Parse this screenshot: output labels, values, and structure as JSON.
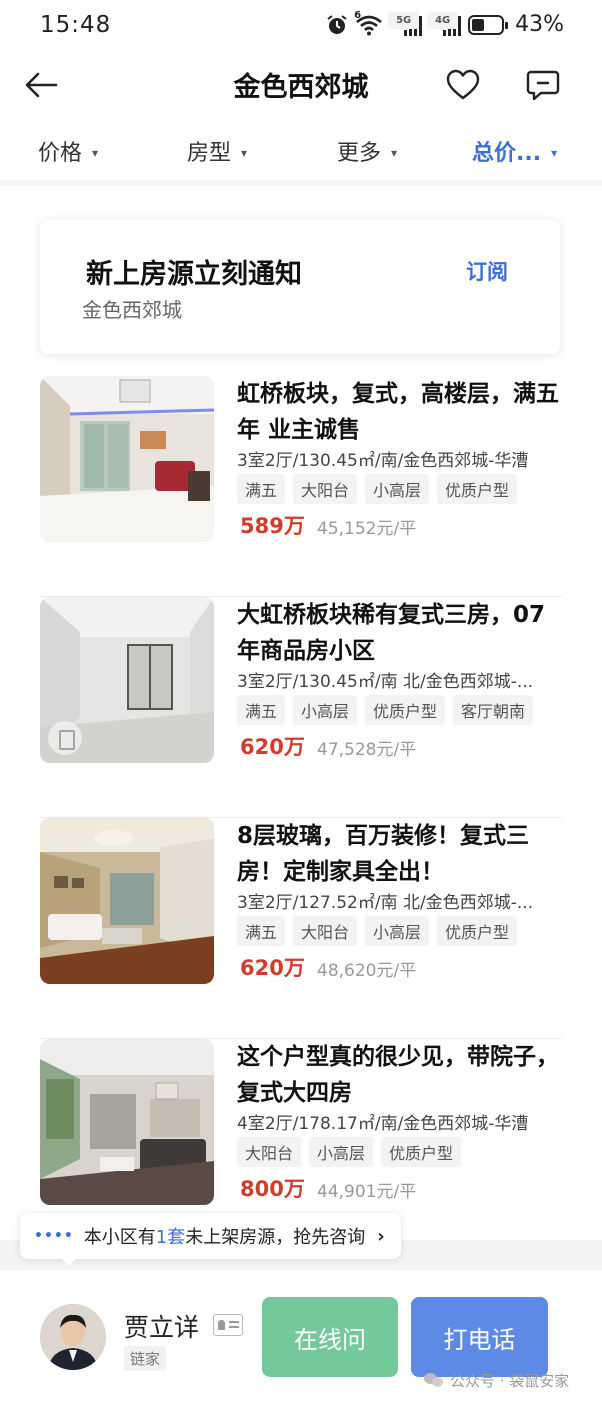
{
  "status_bar": {
    "time": "15:48",
    "battery": "43%",
    "battery_level": 0.43,
    "net_5g": "5G",
    "net_4g": "4G",
    "wifi_tag": "6"
  },
  "header": {
    "title": "金色西郊城",
    "back_icon": "arrow-left-icon",
    "fav_icon": "heart-icon",
    "msg_icon": "message-icon"
  },
  "filters": [
    {
      "label": "价格",
      "active": false
    },
    {
      "label": "房型",
      "active": false
    },
    {
      "label": "更多",
      "active": false
    },
    {
      "label": "总价...",
      "active": true
    }
  ],
  "subscribe": {
    "title": "新上房源立刻通知",
    "subtitle": "金色西郊城",
    "button": "订阅"
  },
  "listings": [
    {
      "title": "虹桥板块，复式，高楼层，满五年 业主诚售",
      "meta": "3室2厅/130.45㎡/南/金色西郊城-华漕",
      "tags": [
        "满五",
        "大阳台",
        "小高层",
        "优质户型"
      ],
      "price": "589万",
      "unit_price": "45,152元/平"
    },
    {
      "title": "大虹桥板块稀有复式三房，07年商品房小区",
      "meta": "3室2厅/130.45㎡/南 北/金色西郊城-...",
      "tags": [
        "满五",
        "小高层",
        "优质户型",
        "客厅朝南"
      ],
      "price": "620万",
      "unit_price": "47,528元/平"
    },
    {
      "title": "8层玻璃，百万装修！复式三房！定制家具全出！",
      "meta": "3室2厅/127.52㎡/南 北/金色西郊城-...",
      "tags": [
        "满五",
        "大阳台",
        "小高层",
        "优质户型"
      ],
      "price": "620万",
      "unit_price": "48,620元/平"
    },
    {
      "title": "这个户型真的很少见，带院子，复式大四房",
      "meta": "4室2厅/178.17㎡/南/金色西郊城-华漕",
      "tags": [
        "大阳台",
        "小高层",
        "优质户型"
      ],
      "price": "800万",
      "unit_price": "44,901元/平"
    }
  ],
  "tip": {
    "prefix": "本小区有",
    "count": "1套",
    "suffix": "未上架房源，抢先咨询"
  },
  "agent": {
    "name": "贾立详",
    "company": "链家",
    "chat_button": "在线问",
    "call_button": "打电话"
  },
  "watermark": "公众号 · 袋鼠安家",
  "colors": {
    "accent": "#3b6fd4",
    "price": "#d23c2a",
    "chat": "#74c99a",
    "call": "#5c8ae6"
  }
}
